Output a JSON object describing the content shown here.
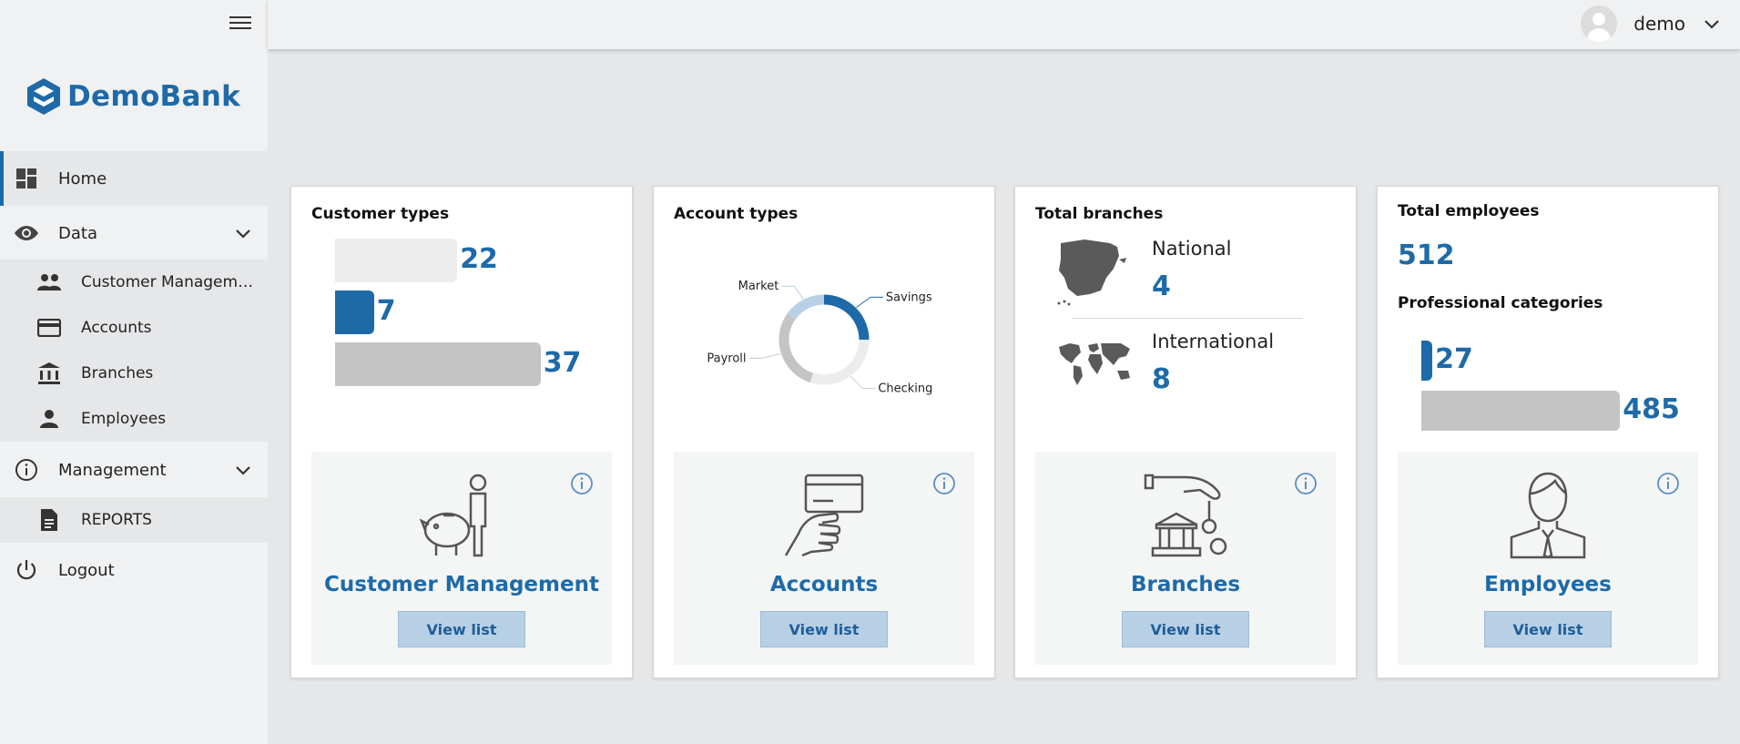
{
  "app": {
    "brand": "DemoBank"
  },
  "topbar": {
    "username": "demo"
  },
  "sidebar": {
    "items": [
      {
        "label": "Home",
        "icon": "dashboard-icon"
      },
      {
        "label": "Data",
        "icon": "eye-icon"
      },
      {
        "label": "Customer Management",
        "icon": "people-icon"
      },
      {
        "label": "Accounts",
        "icon": "credit-card-icon"
      },
      {
        "label": "Branches",
        "icon": "bank-icon"
      },
      {
        "label": "Employees",
        "icon": "person-icon"
      },
      {
        "label": "Management",
        "icon": "info-icon"
      },
      {
        "label": "REPORTS",
        "icon": "document-icon"
      },
      {
        "label": "Logout",
        "icon": "power-icon"
      }
    ]
  },
  "cards": {
    "customers": {
      "title": "Customer types",
      "panel_title": "Customer Management",
      "button": "View list"
    },
    "accounts": {
      "title": "Account types",
      "panel_title": "Accounts",
      "button": "View list"
    },
    "branches": {
      "title": "Total branches",
      "panel_title": "Branches",
      "button": "View list",
      "national_label": "National",
      "national_value": "4",
      "international_label": "International",
      "international_value": "8"
    },
    "employees": {
      "title": "Total employees",
      "total": "512",
      "sub_title": "Professional categories",
      "panel_title": "Employees",
      "button": "View list"
    }
  },
  "colors": {
    "accent": "#1e6aa8",
    "bar_light": "#ececec",
    "bar_gray": "#c4c4c4",
    "button_bg": "#b8d0e6"
  },
  "chart_data": [
    {
      "type": "bar",
      "orientation": "horizontal",
      "values": [
        22,
        7,
        37
      ],
      "colors": [
        "#ececec",
        "#1e6aa8",
        "#c4c4c4"
      ]
    },
    {
      "type": "pie",
      "donut": true,
      "categories": [
        "Savings",
        "Checking",
        "Payroll",
        "Market"
      ],
      "values": [
        25,
        30,
        30,
        15
      ],
      "colors": [
        "#1e6aa8",
        "#ececec",
        "#c4c4c4",
        "#b8d0e6"
      ]
    },
    {
      "type": "bar",
      "orientation": "horizontal",
      "values": [
        27,
        485
      ],
      "colors": [
        "#1e6aa8",
        "#c4c4c4"
      ]
    }
  ]
}
